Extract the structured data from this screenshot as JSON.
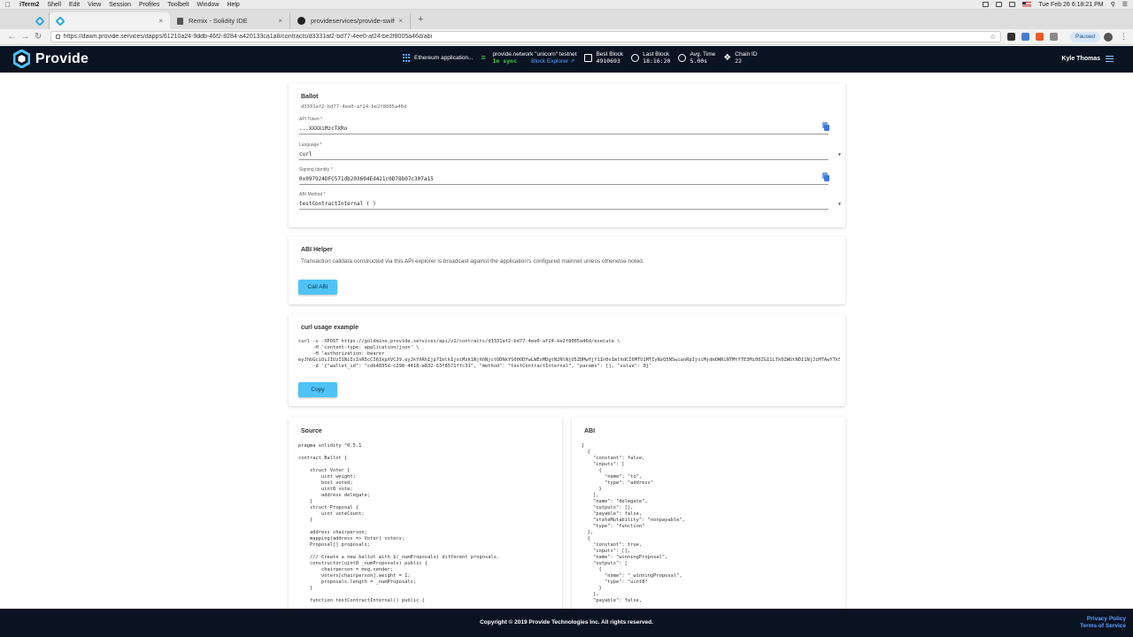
{
  "os_menubar": {
    "app": "iTerm2",
    "menus": [
      "Shell",
      "Edit",
      "View",
      "Session",
      "Profiles",
      "Toolbelt",
      "Window",
      "Help"
    ],
    "clock": "Tue Feb 26  6:18:21 PM"
  },
  "browser": {
    "tabs": [
      {
        "label": ""
      },
      {
        "label": ""
      },
      {
        "label": "Remix - Solidity IDE"
      },
      {
        "label": "provideservices/provide-swift"
      }
    ],
    "url": "https://dawn.provide.services/dapps/61210a24-9ddb-46f2-8284-a420133ca1a8/contracts/d3331af2-bd77-4ee0-af24-be2f8005a46d/abi",
    "profile_status": "Paused"
  },
  "header": {
    "brand": "Provide",
    "application": "Ethereum application...",
    "network": {
      "name": "provide.network \"unicorn\" testnet",
      "status": "In sync",
      "explorer_link": "Block Explorer"
    },
    "best_block": {
      "label": "Best Block",
      "value": "4910693"
    },
    "last_block": {
      "label": "Last Block",
      "value": "18:16:20"
    },
    "avg_time": {
      "label": "Avg. Time",
      "value": "5.00s"
    },
    "chain_id": {
      "label": "Chain ID",
      "value": "22"
    },
    "user": "Kyle Thomas"
  },
  "ballot_card": {
    "title": "Ballot",
    "contract_id": "d3331af2-bd77-4ee0-af24-be2f8005a46d",
    "api_token": {
      "label": "API Token *",
      "value": "...XXXXiMzcTXRo"
    },
    "language": {
      "label": "Language *",
      "value": "curl"
    },
    "signing_identity": {
      "label": "Signing Identity *",
      "value": "0x097924DFC571db203604Ed421c0D78b07c307a15"
    },
    "abi_method": {
      "label": "ABI Method *",
      "value": "testContractInternal ( )"
    }
  },
  "helper_card": {
    "title": "ABI Helper",
    "description": "Transaction calldata constructed via this API explorer is broadcast against the application's configured mainnet unless otherwise noted.",
    "button": "Call ABI"
  },
  "curl_card": {
    "title": "curl usage example",
    "code": "curl -v -XPOST https://goldmine.provide.services/api/v1/contracts/d3331af2-bd77-4ee0-af24-be2f8005a46d/execute \\\n     -H 'content-type: application/json' \\\n     -H 'authorization: bearer\neyJhbGciOiJIUzI1NiIsInR5cCI6IkpXVCJ9.eyJkYXRhIjp7ImlkIjoiMzk1NjhhNjctODNkYS00ODYwLWExMDgtN2NlNjU5ZDMwYjY1In0sImlhdCI6MTU1MTIyNzQ5NSwianRpIjoiMjdmOWRiNTMtYTE3Mi00ZGI1LTk0ZWUtNDI1NjJiMTAwYTk5Iiwic3ViIjoidXNlcjozOTU2OGE2Ny04M2RhLTQ4NjAtYTEwOC03Y2U2NTlkMzBiNjUifQ.XXXXiMzcTXRo' \\\n     -d '{\"wallet_id\": \"cdb4835d-c298-4418-a832-63f8571ffc31\", \"method\": \"testContractInternal\", \"params\": [], \"value\": 0}'",
    "button": "Copy"
  },
  "source_card": {
    "title": "Source",
    "code": "pragma solidity ^0.5.1\n\ncontract Ballot {\n\n    struct Voter {\n        uint weight;\n        bool voted;\n        uint8 vote;\n        address delegate;\n    }\n    struct Proposal {\n        uint voteCount;\n    }\n\n    address chairperson;\n    mapping(address => Voter) voters;\n    Proposal[] proposals;\n\n    /// Create a new ballot with $(_numProposals) different proposals.\n    constructor(uint8 _numProposals) public {\n        chairperson = msg.sender;\n        voters[chairperson].weight = 1;\n        proposals.length = _numProposals;\n    }\n\n    function testContractInternal() public {"
  },
  "abi_card": {
    "title": "ABI",
    "code": "[\n  {\n    \"constant\": false,\n    \"inputs\": [\n      {\n        \"name\": \"to\",\n        \"type\": \"address\"\n      }\n    ],\n    \"name\": \"delegate\",\n    \"outputs\": [],\n    \"payable\": false,\n    \"stateMutability\": \"nonpayable\",\n    \"type\": \"function\"\n  },\n  {\n    \"constant\": true,\n    \"inputs\": [],\n    \"name\": \"winningProposal\",\n    \"outputs\": [\n      {\n        \"name\": \"_winningProposal\",\n        \"type\": \"uint8\"\n      }\n    ],\n    \"payable\": false,"
  },
  "footer": {
    "copyright": "Copyright © 2019 Provide Technologies Inc. All rights reserved.",
    "privacy": "Privacy Policy",
    "terms": "Terms of Service"
  },
  "colors": {
    "header_bg": "#0a1322",
    "accent_button": "#4fc3f7",
    "sync_green": "#3fd24a",
    "link_blue": "#5aa0ff"
  }
}
